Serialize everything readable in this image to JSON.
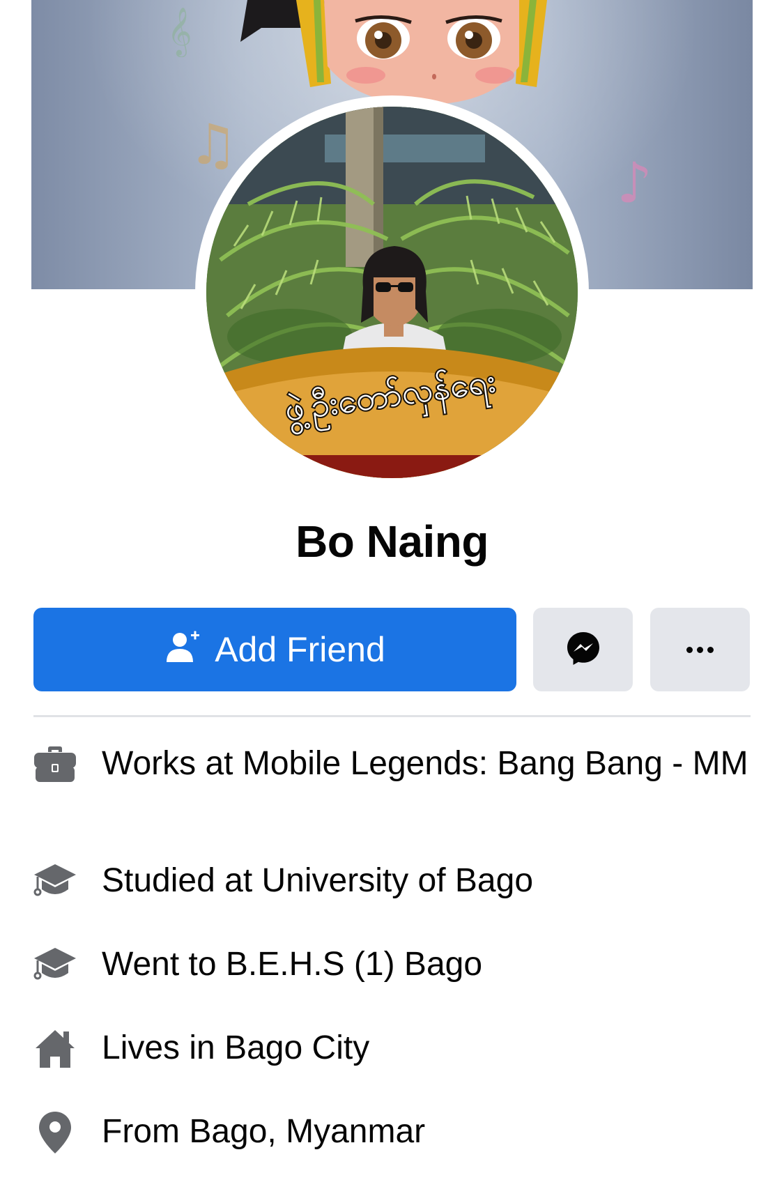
{
  "profile": {
    "name": "Bo Naing",
    "photo_caption": "ဖွဲ့ဦးတော်လှန်ရေး"
  },
  "actions": {
    "add_friend_label": "Add Friend",
    "add_friend_icon": "add-friend-icon",
    "message_icon": "messenger-icon",
    "more_icon": "more-options-icon"
  },
  "details": [
    {
      "icon": "briefcase-icon",
      "prefix": "Works at ",
      "value": "Mobile Legends: Bang Bang - MM"
    },
    {
      "icon": "graduation-cap-icon",
      "prefix": "Studied at ",
      "value": "University of Bago"
    },
    {
      "icon": "graduation-cap-icon",
      "prefix": "Went to ",
      "value": "B.E.H.S (1) Bago"
    },
    {
      "icon": "home-icon",
      "prefix": "Lives in ",
      "value": "Bago City"
    },
    {
      "icon": "location-pin-icon",
      "prefix": "From ",
      "value": "Bago, Myanmar"
    }
  ],
  "colors": {
    "primary": "#1b74e4",
    "secondary_button": "#e4e6eb",
    "icon_gray": "#65676b",
    "text": "#050505"
  }
}
